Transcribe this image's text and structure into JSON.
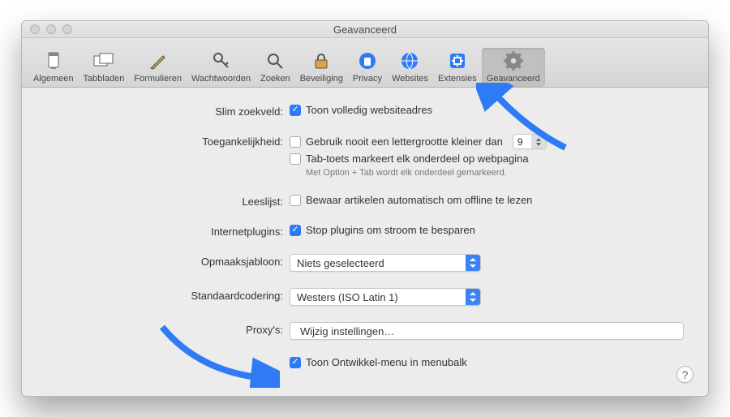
{
  "window": {
    "title": "Geavanceerd"
  },
  "toolbar": [
    {
      "key": "general",
      "label": "Algemeen"
    },
    {
      "key": "tabs",
      "label": "Tabbladen"
    },
    {
      "key": "forms",
      "label": "Formulieren"
    },
    {
      "key": "passwords",
      "label": "Wachtwoorden"
    },
    {
      "key": "search",
      "label": "Zoeken"
    },
    {
      "key": "security",
      "label": "Beveiliging"
    },
    {
      "key": "privacy",
      "label": "Privacy"
    },
    {
      "key": "websites",
      "label": "Websites"
    },
    {
      "key": "extensions",
      "label": "Extensies"
    },
    {
      "key": "advanced",
      "label": "Geavanceerd"
    }
  ],
  "labels": {
    "smart_search": "Slim zoekveld:",
    "accessibility": "Toegankelijkheid:",
    "reading_list": "Leeslijst:",
    "plugins": "Internetplugins:",
    "stylesheet": "Opmaaksjabloon:",
    "encoding": "Standaardcodering:",
    "proxies": "Proxy's:"
  },
  "fields": {
    "show_full_url": "Toon volledig websiteadres",
    "never_smaller_than": "Gebruik nooit een lettergrootte kleiner dan",
    "font_size_value": "9",
    "tab_highlights": "Tab-toets markeert elk onderdeel op webpagina",
    "tab_hint": "Met Option + Tab wordt elk onderdeel gemarkeerd.",
    "save_offline": "Bewaar artikelen automatisch om offline te lezen",
    "stop_plugins": "Stop plugins om stroom te besparen",
    "stylesheet_value": "Niets geselecteerd",
    "encoding_value": "Westers (ISO Latin 1)",
    "proxies_button": "Wijzig instellingen…",
    "develop_menu": "Toon Ontwikkel-menu in menubalk"
  },
  "help": "?"
}
